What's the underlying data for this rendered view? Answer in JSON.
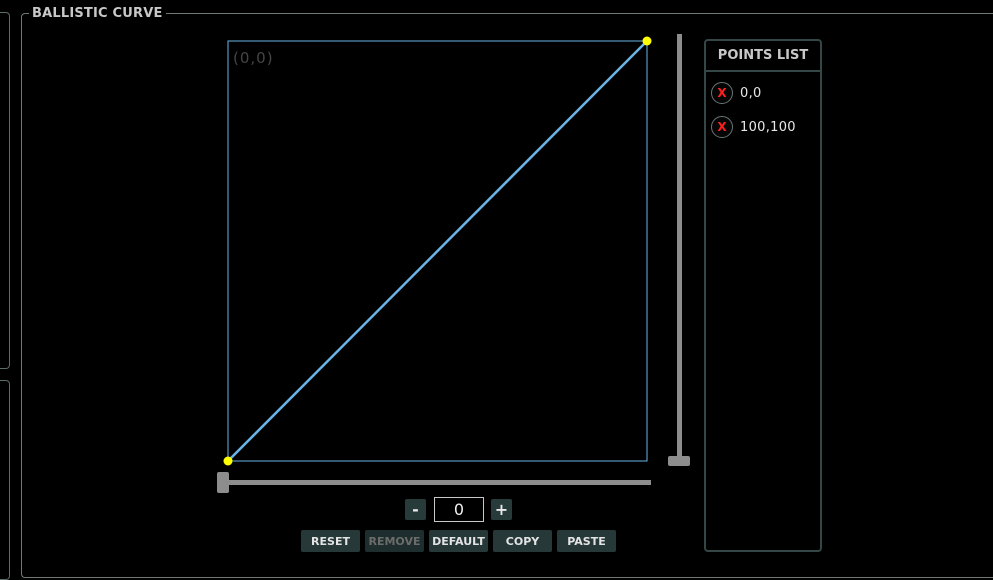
{
  "panel": {
    "title": "BALLISTIC CURVE",
    "origin_label": "(0,0)"
  },
  "curve": {
    "points": [
      [
        0,
        0
      ],
      [
        100,
        100
      ]
    ],
    "line_color": "#6ab4e8",
    "point_color": "#ffff00",
    "border_color": "#6ab4e8"
  },
  "sliders": {
    "horizontal_value": 0,
    "vertical_value": 0
  },
  "stepper": {
    "minus_label": "-",
    "plus_label": "+",
    "value": "0"
  },
  "buttons": {
    "reset": "RESET",
    "remove": "REMOVE",
    "default": "DEFAULT",
    "copy": "COPY",
    "paste": "PASTE"
  },
  "points_list": {
    "title": "POINTS LIST",
    "delete_label": "X",
    "items": [
      {
        "text": "0,0"
      },
      {
        "text": "100,100"
      }
    ]
  }
}
